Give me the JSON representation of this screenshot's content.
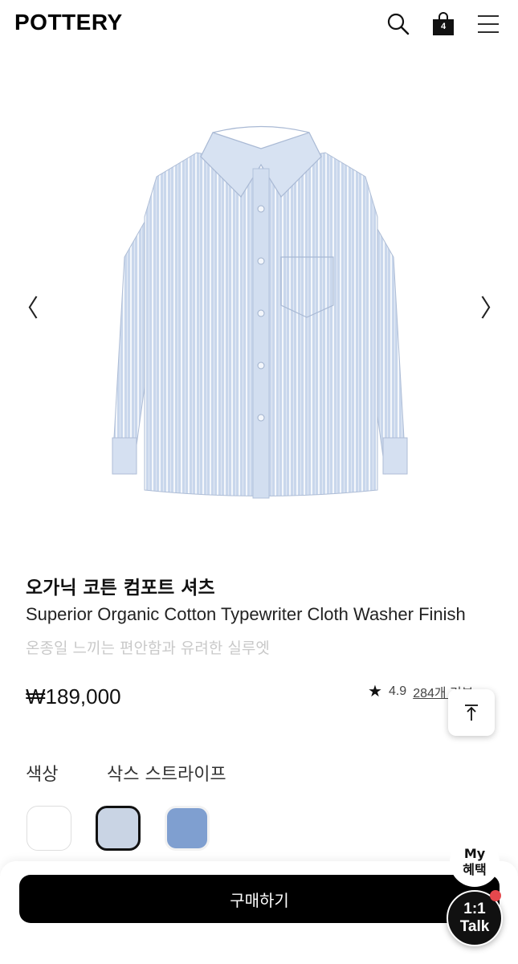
{
  "header": {
    "logo": "POTTERY",
    "cart_count": "4"
  },
  "product": {
    "title_ko": "오가닉 코튼 컴포트 셔츠",
    "title_en": "Superior Organic Cotton Typewriter Cloth Washer Finish",
    "description": "온종일 느끼는 편안함과 유려한 실루엣",
    "price": "₩189,000",
    "rating": "4.9",
    "reviews": "284개 리뷰"
  },
  "options": {
    "color_label": "색상",
    "selected_color": "삭스 스트라이프",
    "swatches": [
      {
        "color": "#ffffff"
      },
      {
        "color": "#c9d4e4",
        "selected": true
      },
      {
        "color": "#7f9fd0"
      }
    ]
  },
  "bottom": {
    "buy_label": "구매하기",
    "my_benefit_line1": "My",
    "my_benefit_line2": "혜택",
    "talk_line1": "1:1",
    "talk_line2": "Talk"
  },
  "icons": {
    "prev": "〈",
    "next": "〉",
    "star": "★"
  }
}
